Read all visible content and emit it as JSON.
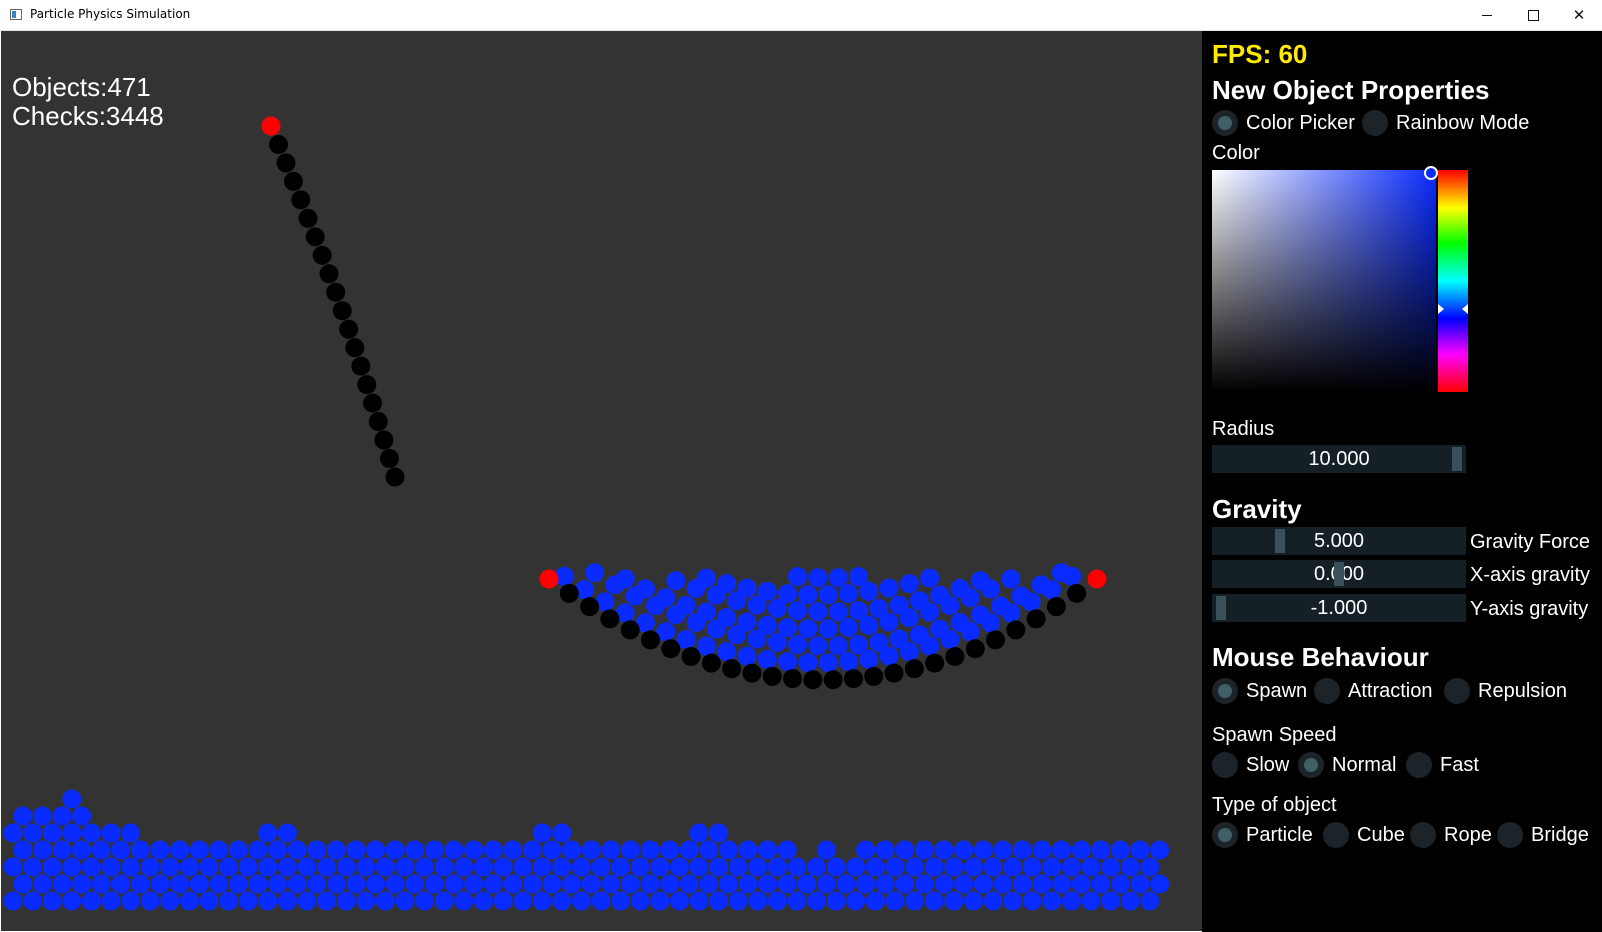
{
  "window": {
    "title": "Particle Physics Simulation",
    "controls": [
      "minimize-icon",
      "maximize-icon",
      "close-icon"
    ]
  },
  "hud": {
    "objects_label": "Objects:471",
    "checks_label": "Checks:3448"
  },
  "colors": {
    "canvas_bg": "#333333",
    "particle_blue": "#0a2bff",
    "anchor_red": "#ff0000",
    "rope_black": "#000000",
    "fps_yellow": "#ffea00",
    "panel_bg": "#000000"
  },
  "panel": {
    "fps": "FPS: 60",
    "new_object_heading": "New Object Properties",
    "color_mode": [
      {
        "label": "Color Picker",
        "selected": true
      },
      {
        "label": "Rainbow Mode",
        "selected": false
      }
    ],
    "color_label": "Color",
    "radius_label": "Radius",
    "radius_value": "10.000",
    "radius_fraction": 1.0,
    "gravity_heading": "Gravity",
    "gravity_sliders": [
      {
        "label": "Gravity Force",
        "value": "5.000",
        "fraction": 0.25
      },
      {
        "label": "X-axis gravity",
        "value": "0.000",
        "fraction": 0.5
      },
      {
        "label": "Y-axis gravity",
        "value": "-1.000",
        "fraction": 0.0
      }
    ],
    "mouse_heading": "Mouse Behaviour",
    "mouse_options": [
      {
        "label": "Spawn",
        "selected": true
      },
      {
        "label": "Attraction",
        "selected": false
      },
      {
        "label": "Repulsion",
        "selected": false
      }
    ],
    "spawn_speed_label": "Spawn Speed",
    "spawn_speed_options": [
      {
        "label": "Slow",
        "selected": false
      },
      {
        "label": "Normal",
        "selected": true
      },
      {
        "label": "Fast",
        "selected": false
      }
    ],
    "object_type_label": "Type of object",
    "object_type_options": [
      {
        "label": "Particle",
        "selected": true
      },
      {
        "label": "Cube",
        "selected": false
      },
      {
        "label": "Rope",
        "selected": false
      },
      {
        "label": "Bridge",
        "selected": false
      }
    ]
  }
}
